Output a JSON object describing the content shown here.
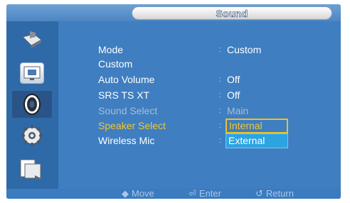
{
  "header": {
    "title": "Sound"
  },
  "sidebar": {
    "items": [
      {
        "icon": "picture-icon"
      },
      {
        "icon": "screen-icon"
      },
      {
        "icon": "sound-icon",
        "active": true
      },
      {
        "icon": "setup-icon"
      },
      {
        "icon": "multi-control-icon"
      }
    ]
  },
  "menu": {
    "rows": [
      {
        "label": "Mode",
        "value": "Custom"
      },
      {
        "label": "Custom",
        "value": ""
      },
      {
        "label": "Auto Volume",
        "value": "Off"
      },
      {
        "label": "SRS TS XT",
        "value": "Off"
      },
      {
        "label": "Sound Select",
        "value": "Main",
        "disabled": true
      },
      {
        "label": "Speaker Select",
        "value": "",
        "selected": true
      },
      {
        "label": "Wireless Mic",
        "value": ""
      }
    ],
    "separator": ":",
    "dropdown": {
      "options": [
        "Internal",
        "External"
      ],
      "current": "Internal"
    }
  },
  "footer": {
    "move": "Move",
    "enter": "Enter",
    "return": "Return"
  },
  "colors": {
    "background": "#3f7ec0",
    "sidebar": "#2f6aa8",
    "highlight": "#f3c631",
    "dropdown_other": "#2da4e0"
  }
}
